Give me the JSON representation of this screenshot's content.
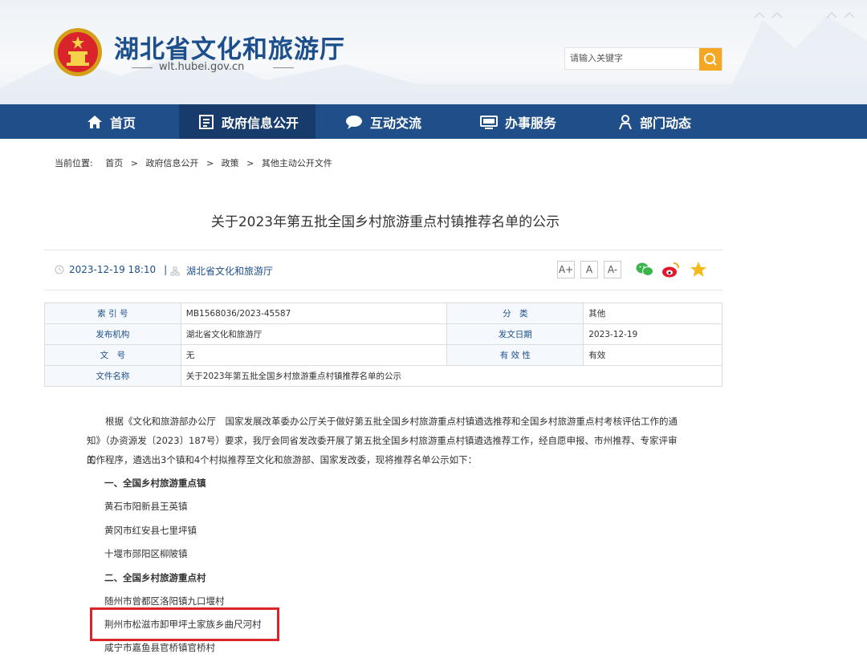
{
  "header": {
    "site_title": "湖北省文化和旅游厅",
    "site_domain": "wlt.hubei.gov.cn",
    "search_placeholder": "请输入关键字"
  },
  "nav": {
    "items": [
      {
        "label": "首页",
        "icon": "home-icon"
      },
      {
        "label": "政府信息公开",
        "icon": "document-list-icon"
      },
      {
        "label": "互动交流",
        "icon": "chat-bubble-icon"
      },
      {
        "label": "办事服务",
        "icon": "monitor-icon"
      },
      {
        "label": "部门动态",
        "icon": "person-icon"
      }
    ],
    "active_index": 1
  },
  "breadcrumb": {
    "prefix": "当前位置:",
    "items": [
      "首页",
      "政府信息公开",
      "政策",
      "其他主动公开文件"
    ],
    "separator": ">"
  },
  "article": {
    "title": "关于2023年第五批全国乡村旅游重点村镇推荐名单的公示",
    "date": "2023-12-19 18:10",
    "divider": "|",
    "source": "湖北省文化和旅游厅",
    "font_sizes": [
      "A+",
      "A",
      "A-"
    ]
  },
  "info_table": {
    "rows": [
      {
        "label1": "索 引 号",
        "value1": "MB1568036/2023-45587",
        "label2": "分　类",
        "value2": "其他"
      },
      {
        "label1": "发布机构",
        "value1": "湖北省文化和旅游厅",
        "label2": "发文日期",
        "value2": "2023-12-19"
      },
      {
        "label1": "文　号",
        "value1": "无",
        "label2": "有 效 性",
        "value2": "有效"
      },
      {
        "label1": "文件名称",
        "value1": "关于2023年第五批全国乡村旅游重点村镇推荐名单的公示",
        "label2": "",
        "value2": ""
      }
    ]
  },
  "body": {
    "intro_lines": [
      "　　根据《文化和旅游部办公厅　国家发展改革委办公厅关于做好第五批全国乡村旅游重点村镇遴选推荐和全国乡村旅游重点村考核评估工作的通",
      "知》（办资源发〔2023〕187号）要求，我厅会同省发改委开展了第五批全国乡村旅游重点村镇遴选推荐工作，经自愿申报、市州推荐、专家评审的",
      "工作程序，遴选出3个镇和4个村拟推荐至文化和旅游部、国家发改委，现将推荐名单公示如下："
    ],
    "section1_heading": "一、全国乡村旅游重点镇",
    "section1_items": [
      "黄石市阳新县王英镇",
      "黄冈市红安县七里坪镇",
      "十堰市郧阳区柳陂镇"
    ],
    "section2_heading": "二、全国乡村旅游重点村",
    "section2_items": [
      "随州市曾都区洛阳镇九口堰村",
      "荆州市松滋市卸甲坪土家族乡曲尺河村",
      "咸宁市嘉鱼县官桥镇官桥村"
    ]
  },
  "colors": {
    "brand_blue": "#1f4e89",
    "nav_active": "#173c6b",
    "search_button": "#f5a623",
    "highlight_border": "#d9242b"
  }
}
